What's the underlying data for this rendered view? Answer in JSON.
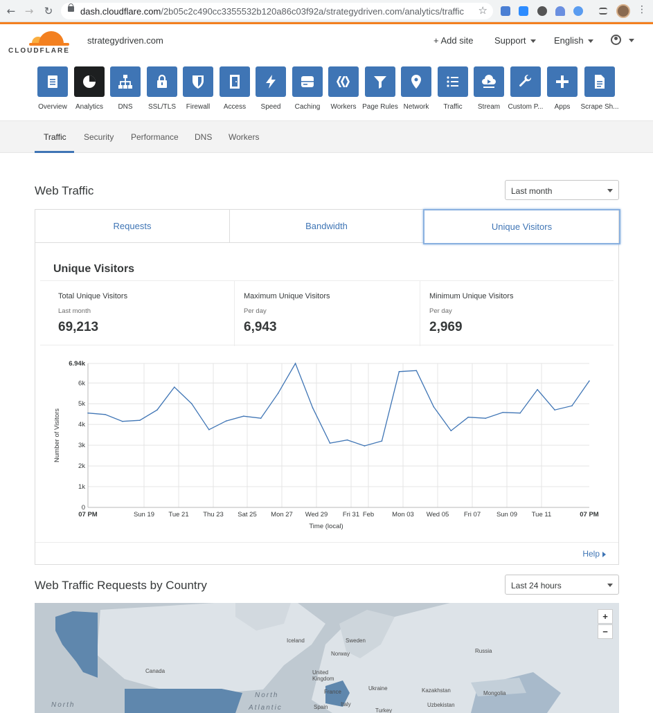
{
  "browser": {
    "url_host": "dash.cloudflare.com",
    "url_path": "/2b05c2c490cc3355532b120a86c03f92a/strategydriven.com/analytics/traffic"
  },
  "header": {
    "brand": "CLOUDFLARE",
    "site": "strategydriven.com",
    "add_site": "+ Add site",
    "support": "Support",
    "language": "English"
  },
  "apps": [
    {
      "label": "Overview",
      "icon": "clipboard-icon"
    },
    {
      "label": "Analytics",
      "icon": "pie-chart-icon"
    },
    {
      "label": "DNS",
      "icon": "network-tree-icon"
    },
    {
      "label": "SSL/TLS",
      "icon": "lock-icon"
    },
    {
      "label": "Firewall",
      "icon": "shield-icon"
    },
    {
      "label": "Access",
      "icon": "door-icon"
    },
    {
      "label": "Speed",
      "icon": "lightning-icon"
    },
    {
      "label": "Caching",
      "icon": "server-icon"
    },
    {
      "label": "Workers",
      "icon": "workers-icon"
    },
    {
      "label": "Page Rules",
      "icon": "funnel-icon"
    },
    {
      "label": "Network",
      "icon": "location-pin-icon"
    },
    {
      "label": "Traffic",
      "icon": "list-icon"
    },
    {
      "label": "Stream",
      "icon": "cloud-play-icon"
    },
    {
      "label": "Custom P...",
      "icon": "wrench-icon"
    },
    {
      "label": "Apps",
      "icon": "plus-icon"
    },
    {
      "label": "Scrape Sh...",
      "icon": "document-icon"
    }
  ],
  "subnav": [
    "Traffic",
    "Security",
    "Performance",
    "DNS",
    "Workers"
  ],
  "web_traffic": {
    "title": "Web Traffic",
    "range": "Last month",
    "tabs": [
      "Requests",
      "Bandwidth",
      "Unique Visitors"
    ],
    "panel_title": "Unique Visitors",
    "stats": [
      {
        "label": "Total Unique Visitors",
        "sub": "Last month",
        "value": "69,213"
      },
      {
        "label": "Maximum Unique Visitors",
        "sub": "Per day",
        "value": "6,943"
      },
      {
        "label": "Minimum Unique Visitors",
        "sub": "Per day",
        "value": "2,969"
      }
    ],
    "help": "Help"
  },
  "chart_data": {
    "type": "line",
    "xlabel": "Time (local)",
    "ylabel": "Number of Visitors",
    "ylim": [
      0,
      6943
    ],
    "y_ticks": [
      "0",
      "1k",
      "2k",
      "3k",
      "4k",
      "5k",
      "6k",
      "6.94k"
    ],
    "x_ticks": [
      "07 PM",
      "Sun 19",
      "Tue 21",
      "Thu 23",
      "Sat 25",
      "Mon 27",
      "Wed 29",
      "Fri 31",
      "Feb",
      "Mon 03",
      "Wed 05",
      "Fri 07",
      "Sun 09",
      "Tue 11",
      "07 PM"
    ],
    "grid": true,
    "series": [
      {
        "values": [
          4550,
          4480,
          4150,
          4200,
          4700,
          5800,
          5000,
          3750,
          4170,
          4400,
          4300,
          5500,
          6943,
          4800,
          3100,
          3250,
          2969,
          3200,
          6550,
          6600,
          4850,
          3700,
          4350,
          4300,
          4580,
          4550,
          5680,
          4700,
          4900,
          6100
        ]
      }
    ]
  },
  "country": {
    "title": "Web Traffic Requests by Country",
    "range": "Last 24 hours",
    "zoom_in": "+",
    "zoom_out": "−",
    "labels": [
      "Iceland",
      "Sweden",
      "Norway",
      "Russia",
      "Canada",
      "United Kingdom",
      "France",
      "Spain",
      "Italy",
      "Ukraine",
      "Kazakhstan",
      "Mongolia",
      "Uzbekistan",
      "Turkey"
    ],
    "oceans": [
      "North",
      "North",
      "Atlantic"
    ]
  }
}
